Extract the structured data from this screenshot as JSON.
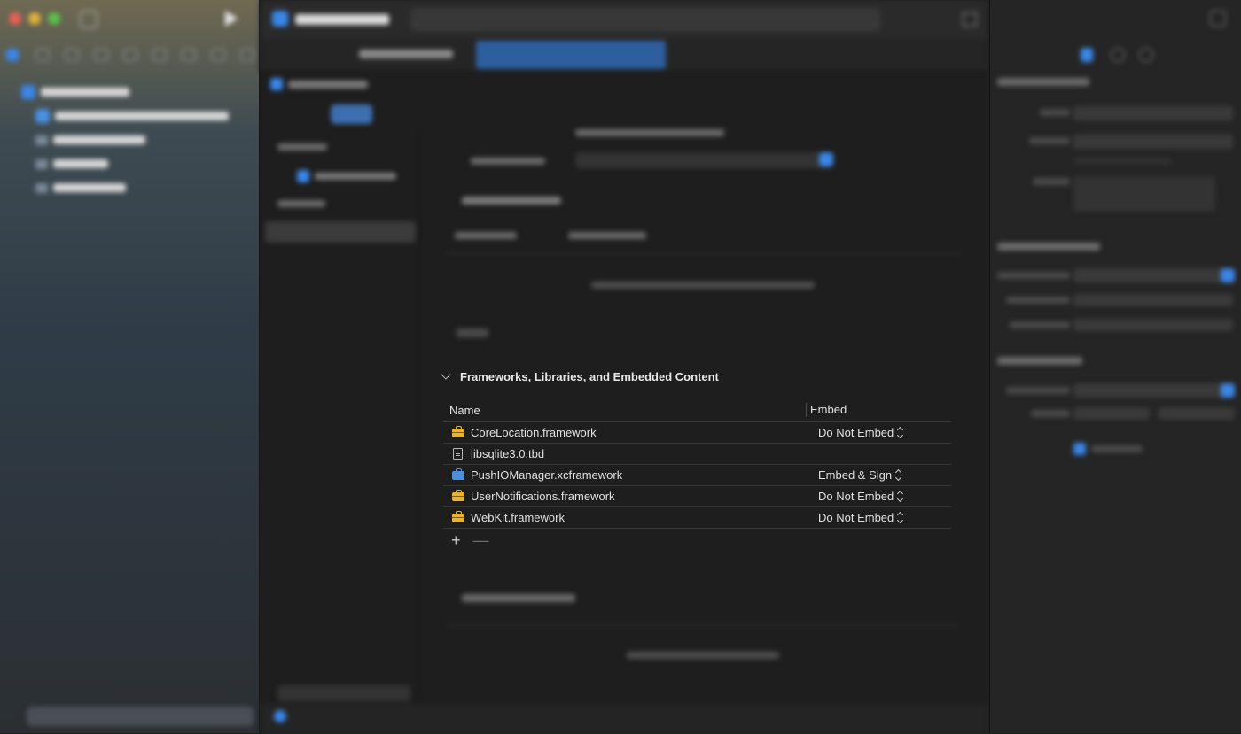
{
  "frameworks_section": {
    "title": "Frameworks, Libraries, and Embedded Content",
    "columns": {
      "name": "Name",
      "embed": "Embed"
    },
    "rows": [
      {
        "name": "CoreLocation.framework",
        "icon": "toolbox-icon",
        "icon_color": "#e9b32f",
        "embed": "Do Not Embed"
      },
      {
        "name": "libsqlite3.0.tbd",
        "icon": "document-icon",
        "icon_color": "#b8b8b8",
        "embed": ""
      },
      {
        "name": "PushIOManager.xcframework",
        "icon": "toolbox-icon",
        "icon_color": "#4a90e2",
        "embed": "Embed & Sign"
      },
      {
        "name": "UserNotifications.framework",
        "icon": "toolbox-icon",
        "icon_color": "#e9b32f",
        "embed": "Do Not Embed"
      },
      {
        "name": "WebKit.framework",
        "icon": "toolbox-icon",
        "icon_color": "#e9b32f",
        "embed": "Do Not Embed"
      }
    ],
    "add_symbol": "+",
    "remove_symbol": "—"
  },
  "colors": {
    "accent": "#3a86e8",
    "framework_icon": "#e9b32f",
    "xcframework_icon": "#4a90e2",
    "background": "#1e1e1e"
  }
}
